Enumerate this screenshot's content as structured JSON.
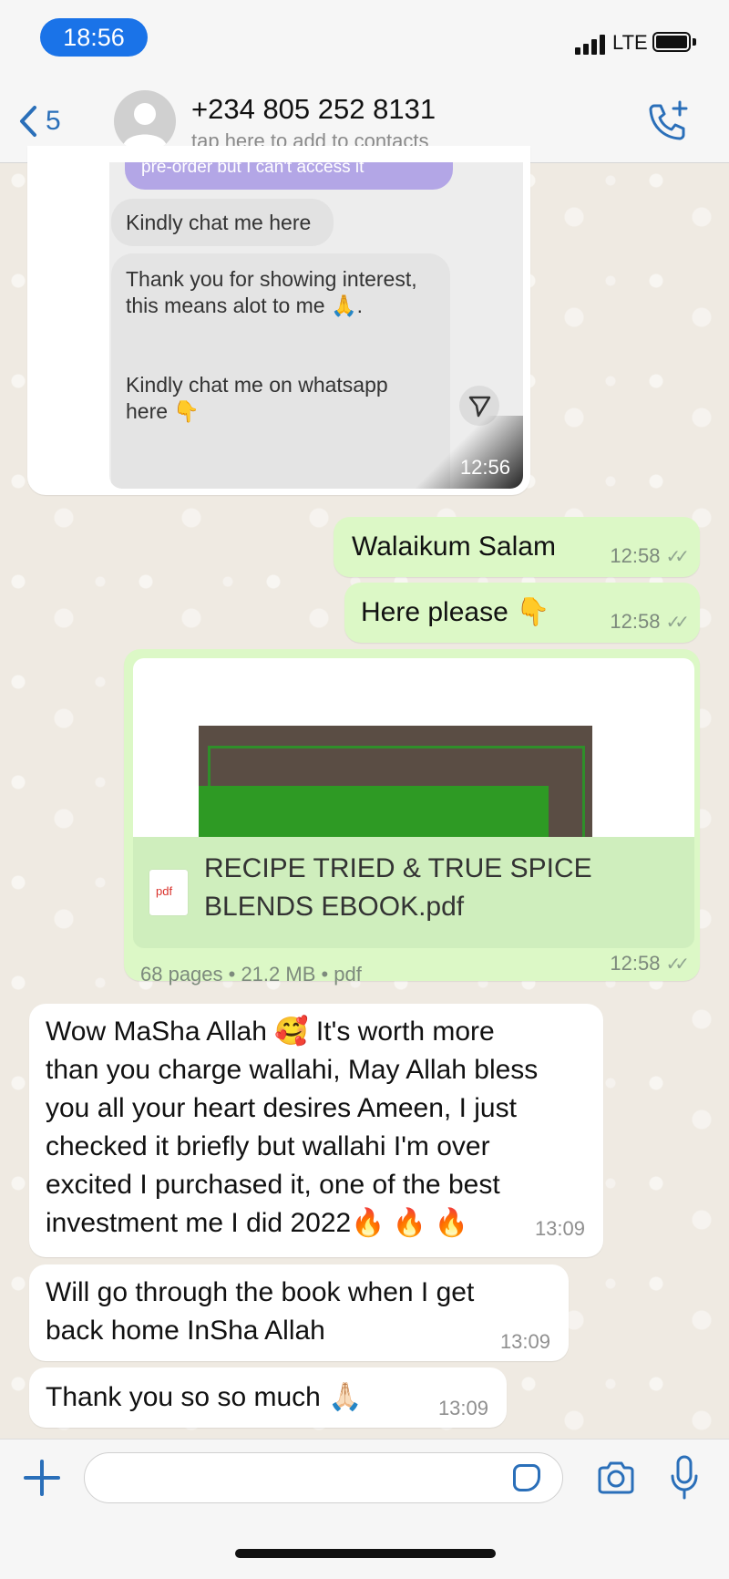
{
  "status_bar": {
    "time": "18:56",
    "network": "LTE"
  },
  "header": {
    "back_count": "5",
    "contact_name": "+234 805 252 8131",
    "contact_subtitle": "tap here to add to contacts"
  },
  "messages": {
    "m1": {
      "purple_snippet": "pre-order but I can't access it",
      "bubble1": "Kindly chat me here",
      "bubble2_line1": "Thank you for showing interest,",
      "bubble2_line2": "this means alot to me 🙏.",
      "bubble2_line3": "Kindly chat me on whatsapp",
      "bubble2_line4": "here 👇",
      "stamp": "12:56"
    },
    "m2": {
      "text": "Walaikum Salam",
      "time": "12:58"
    },
    "m3": {
      "text": "Here please 👇",
      "time": "12:58"
    },
    "m4": {
      "file_type": "pdf",
      "file_name_line1": "RECIPE TRIED & TRUE SPICE",
      "file_name_line2": "BLENDS EBOOK.pdf",
      "details": "68 pages • 21.2 MB • pdf",
      "time": "12:58"
    },
    "m5": {
      "line1": "Wow MaSha Allah 🥰 It's worth more",
      "line2": "than you charge wallahi, May Allah bless",
      "line3": "you all your heart desires Ameen, I just",
      "line4": "checked it briefly but wallahi I'm over",
      "line5": "excited I purchased it, one of the best",
      "line6": "investment me I did 2022🔥 🔥 🔥",
      "time": "13:09"
    },
    "m6": {
      "line1": "Will go through the book when I get",
      "line2": "back home InSha Allah",
      "time": "13:09"
    },
    "m7": {
      "text": "Thank you so so much 🙏🏻",
      "time": "13:09"
    }
  },
  "colors": {
    "accent": "#2a6fb9",
    "outgoing": "#dcf8c6",
    "incoming": "#ffffff",
    "time_pill": "#1a73e8"
  }
}
